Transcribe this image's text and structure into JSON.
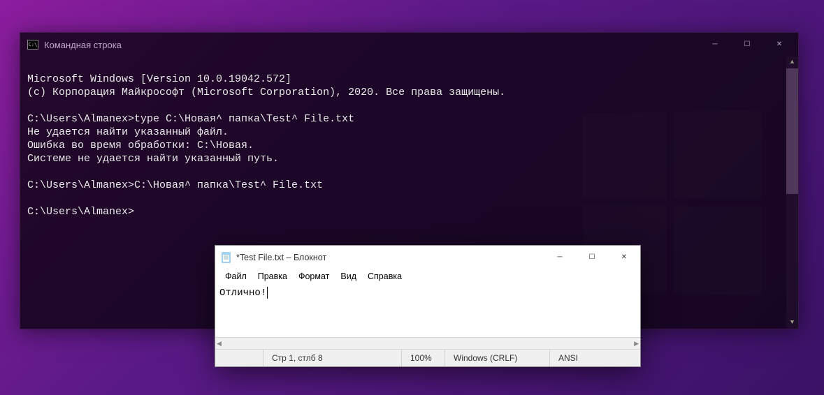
{
  "cmd": {
    "title": "Командная строка",
    "lines": [
      "Microsoft Windows [Version 10.0.19042.572]",
      "(c) Корпорация Майкрософт (Microsoft Corporation), 2020. Все права защищены.",
      "",
      "C:\\Users\\Almanex>type C:\\Новая^ папка\\Test^ File.txt",
      "Не удается найти указанный файл.",
      "Ошибка во время обработки: C:\\Новая.",
      "Системе не удается найти указанный путь.",
      "",
      "C:\\Users\\Almanex>C:\\Новая^ папка\\Test^ File.txt",
      "",
      "C:\\Users\\Almanex>"
    ]
  },
  "notepad": {
    "title": "*Test File.txt – Блокнот",
    "menu": {
      "file": "Файл",
      "edit": "Правка",
      "format": "Формат",
      "view": "Вид",
      "help": "Справка"
    },
    "content": "Отлично!",
    "status": {
      "position": "Стр 1, стлб 8",
      "zoom": "100%",
      "line_ending": "Windows (CRLF)",
      "encoding": "ANSI"
    }
  }
}
